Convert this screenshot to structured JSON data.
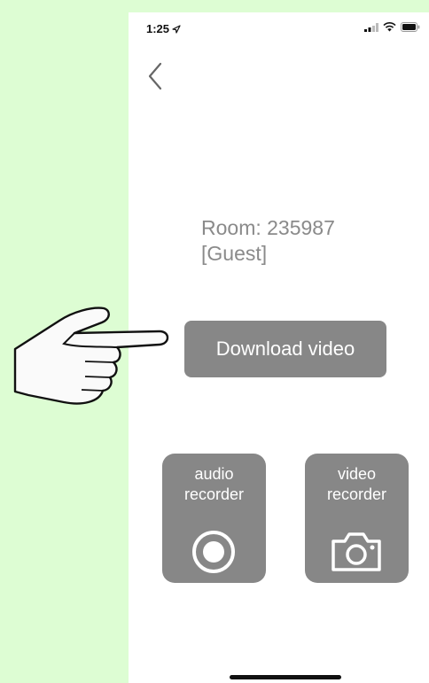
{
  "status_bar": {
    "time": "1:25"
  },
  "room": {
    "line1": "Room: 235987",
    "line2": "[Guest]"
  },
  "download_button": {
    "label": "Download video"
  },
  "recorders": {
    "audio": {
      "line1": "audio",
      "line2": "recorder",
      "icon": "record-icon"
    },
    "video": {
      "line1": "video",
      "line2": "recorder",
      "icon": "camera-icon"
    }
  },
  "annotation": {
    "icon": "pointing-hand-icon"
  },
  "colors": {
    "page_background": "#ddfdd3",
    "button_gray": "#878787",
    "room_text": "#8a8a8a"
  }
}
